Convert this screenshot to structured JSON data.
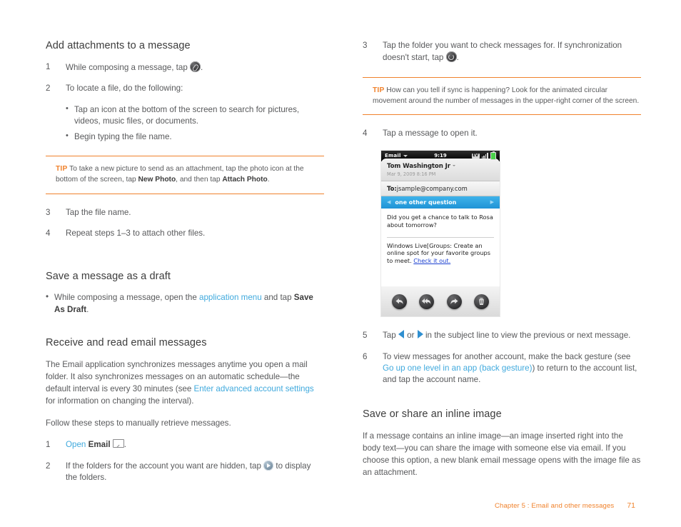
{
  "colors": {
    "accent_orange": "#f0822c",
    "link_blue": "#3fa9dd",
    "body_gray": "#58595b",
    "heading_gray": "#3c3c3c",
    "phone_subject_blue": "#1f93d6"
  },
  "left_column": {
    "section1": {
      "heading": "Add attachments to a message",
      "step1": {
        "num": "1",
        "text_before": "While composing a message, tap",
        "icon": "paperclip-icon",
        "text_after": "."
      },
      "step2": {
        "num": "2",
        "text": "To locate a file, do the following:",
        "bullets": [
          "Tap an icon at the bottom of the screen to search for pictures, videos, music files, or documents.",
          "Begin typing the file name."
        ]
      },
      "tip": {
        "label": "TIP",
        "part1": "To take a new picture to send as an attachment, tap the photo icon at the bottom of the screen, tap ",
        "bold1": "New Photo",
        "part2": ", and then tap ",
        "bold2": "Attach Photo",
        "part3": "."
      },
      "step3": {
        "num": "3",
        "text": "Tap the file name."
      },
      "step4": {
        "num": "4",
        "text": "Repeat steps 1–3 to attach other files."
      }
    },
    "section2": {
      "heading": "Save a message as a draft",
      "bullet": {
        "part1": "While composing a message, open the ",
        "link": "application menu",
        "part2": " and tap ",
        "bold": "Save As Draft",
        "part3": "."
      }
    },
    "section3": {
      "heading": "Receive and read email messages",
      "para1": {
        "part1": "The Email application synchronizes messages anytime you open a mail folder. It also synchronizes messages on an automatic schedule—the default interval is every 30 minutes (see ",
        "link": "Enter advanced account settings",
        "part2": " for information on changing the interval)."
      },
      "para2": "Follow these steps to manually retrieve messages.",
      "step1": {
        "num": "1",
        "link": "Open",
        "bold": "Email",
        "icon": "envelope-icon",
        "text_after": "."
      },
      "step2": {
        "num": "2",
        "text_before": "If the folders for the account you want are hidden, tap",
        "icon": "play-circle-icon",
        "text_after": "to display the folders."
      }
    }
  },
  "right_column": {
    "step3": {
      "num": "3",
      "text_before": "Tap the folder you want to check messages for. If synchronization doesn't start, tap",
      "icon": "sync-icon",
      "text_after": "."
    },
    "tip": {
      "label": "TIP",
      "text": "How can you tell if sync is happening? Look for the animated circular movement around the number of messages in the upper-right corner of the screen."
    },
    "step4": {
      "num": "4",
      "text": "Tap a message to open it."
    },
    "step5": {
      "num": "5",
      "text_before": "Tap",
      "icon_left": "arrow-left-icon",
      "text_or": "or",
      "icon_right": "arrow-right-icon",
      "text_after": "in the subject line to view the previous or next message."
    },
    "step6": {
      "num": "6",
      "part1": "To view messages for another account, make the back gesture (see ",
      "link": "Go up one level in an app (back gesture)",
      "part2": ") to return to the account list, and tap the account name."
    },
    "section4": {
      "heading": "Save or share an inline image",
      "para": "If a message contains an inline image—an image inserted right into the body text—you can share the image with someone else via email. If you choose this option, a new blank email message opens with the image file as an attachment."
    }
  },
  "phone_screenshot": {
    "status_bar": {
      "app_name": "Email",
      "time": "9:19",
      "network": "EV",
      "signal_icon": "signal-bars-icon",
      "battery_icon": "battery-icon"
    },
    "message": {
      "sender": "Tom Washington Jr",
      "date": "Mar 9, 2009 8:16 PM",
      "to_label": "To:",
      "to_value": "jsample@company.com",
      "subject": "one other question",
      "body": "Did you get a chance to talk to Rosa about tomorrow?",
      "promo_text": "Windows Live[Groups: Create an online spot for your favorite groups to meet. ",
      "promo_link": "Check it out."
    },
    "toolbar_buttons": [
      {
        "name": "reply-button"
      },
      {
        "name": "reply-all-button"
      },
      {
        "name": "forward-button"
      },
      {
        "name": "delete-button"
      }
    ]
  },
  "footer": {
    "chapter": "Chapter 5  :  Email and other messages",
    "page": "71"
  }
}
